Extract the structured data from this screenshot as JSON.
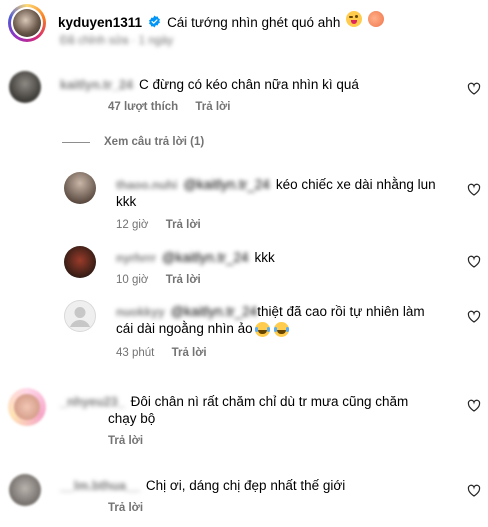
{
  "post": {
    "username": "kyduyen1311",
    "caption": "Cái tướng nhìn ghét quó ahh",
    "edited": "Đã chỉnh sửa · 1 ngày"
  },
  "reply_label": "Trả lời",
  "view_replies": "Xem câu trả lời (1)",
  "comments": [
    {
      "user": "kaitlyn.tr_24",
      "text": "C đừng có kéo chân nữa nhìn kì quá",
      "likes": "47 lượt thích"
    },
    {
      "user": "thaoo.nuhi",
      "mention": "@kaitlyn.tr_24",
      "text_line1": "kéo chiếc xe dài nhằng lun",
      "text_line2": "kkk",
      "time": "12 giờ"
    },
    {
      "user": "nyrhrrr",
      "mention": "@kaitlyn.tr_24",
      "text": "kkk",
      "time": "10 giờ"
    },
    {
      "user": "nuokkyy",
      "mention": "@kaitlyn.tr_24",
      "text_line1": "thiệt đã cao rồi tự nhiên làm",
      "text_line2": "cái dài ngoằng nhìn ảo",
      "time": "43 phút"
    },
    {
      "user": "_nhyeu23_",
      "text_line1": "Đôi chân nì rất chăm chỉ dù tr mưa cũng chăm",
      "text_line2": "chạy bộ"
    },
    {
      "user": "__lm.bthua__",
      "text": "Chị ơi, dáng chị đẹp nhất thế giới"
    }
  ],
  "icons": {
    "verified": "verified-badge-icon",
    "heart": "heart-outline-icon"
  },
  "colors": {
    "verified": "#0095f6",
    "meta": "#737373",
    "mention": "#6b7fd7"
  }
}
